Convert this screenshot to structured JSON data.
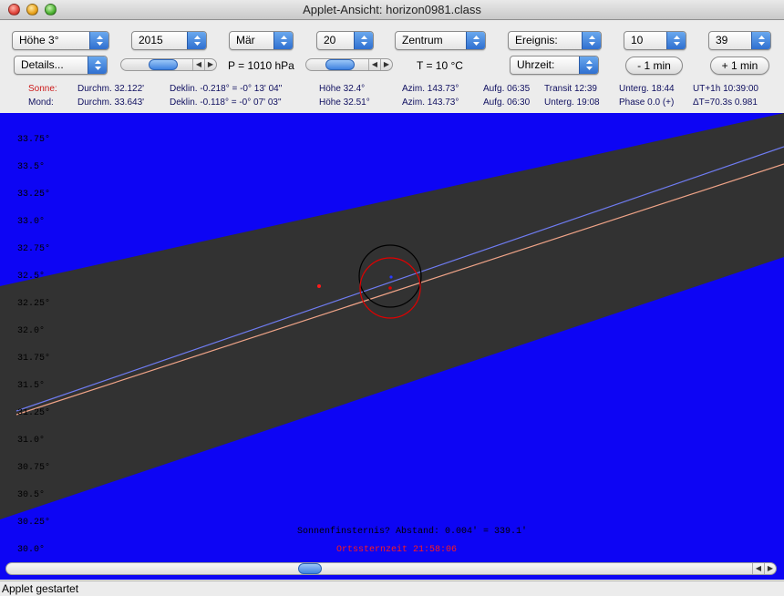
{
  "window": {
    "title": "Applet-Ansicht: horizon0981.class"
  },
  "controls": {
    "height_select": "Höhe 3°",
    "year_select": "2015",
    "month_select": "Mär",
    "day_select": "20",
    "center_select": "Zentrum",
    "event_select": "Ereignis:",
    "hour_select": "10",
    "minute_select": "39",
    "details_select": "Details...",
    "pressure_label": "P = 1010 hPa",
    "temperature_label": "T = 10 °C",
    "time_select": "Uhrzeit:",
    "minus_button": "- 1 min",
    "plus_button": "+ 1 min"
  },
  "sun_row": {
    "name": "Sonne:",
    "diameter": "Durchm. 32.122'",
    "declination": "Deklin. -0.218° = -0° 13' 04\"",
    "altitude": "Höhe 32.4°",
    "azimuth": "Azim. 143.73°",
    "rise": "Aufg. 06:35",
    "transit": "Transit 12:39",
    "set": "Unterg. 18:44",
    "ut": "UT+1h  10:39:00"
  },
  "moon_row": {
    "name": "Mond:",
    "diameter": "Durchm. 33.643'",
    "declination": "Deklin. -0.118° = -0° 07' 03\"",
    "altitude": "Höhe 32.51°",
    "azimuth": "Azim. 143.73°",
    "rise": "Aufg. 06:30",
    "set": "Unterg. 19:08",
    "phase": "Phase 0.0 (+)",
    "delta_t": "ΔT=70.3s  0.981"
  },
  "plot": {
    "y_labels": [
      "33.75°",
      "33.5°",
      "33.25°",
      "33.0°",
      "32.75°",
      "32.5°",
      "32.25°",
      "32.0°",
      "31.75°",
      "31.5°",
      "31.25°",
      "31.0°",
      "30.75°",
      "30.5°",
      "30.25°",
      "30.0°"
    ],
    "eclipse_note": "Sonnenfinsternis? Abstand: 0.004' = 339.1'",
    "sidereal_time": "Ortssternzeit 21:58:06",
    "colors": {
      "sky": "#0d05f4",
      "band": "#323232",
      "moon_path": "#6f7cf2",
      "sun_path": "#f0a488",
      "sun": "#e00000",
      "moon": "#000000"
    }
  },
  "status": {
    "text": "Applet gestartet"
  }
}
